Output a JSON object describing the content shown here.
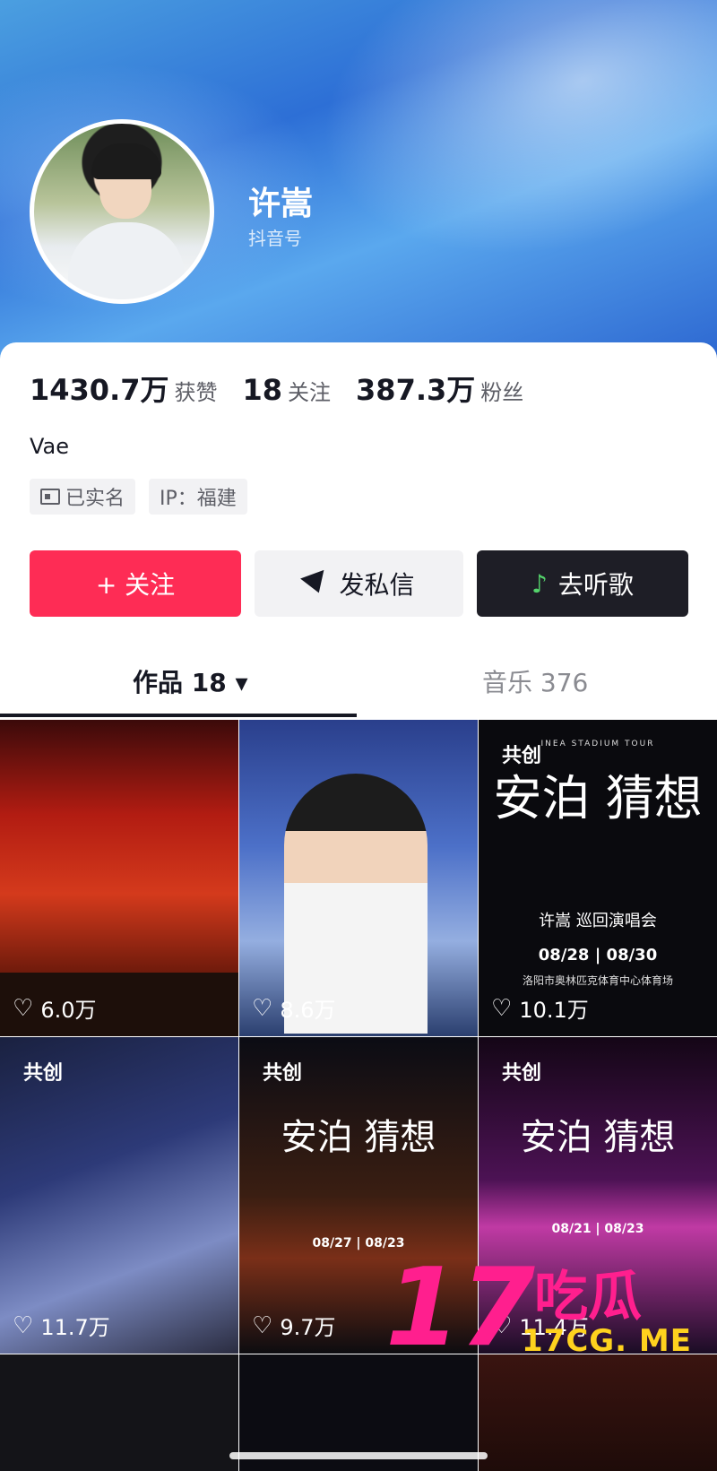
{
  "profile": {
    "name": "许嵩",
    "douyin_id": "抖音号",
    "bio": "Vae"
  },
  "stats": [
    {
      "value": "1430.7万",
      "label": "获赞"
    },
    {
      "value": "18",
      "label": "关注"
    },
    {
      "value": "387.3万",
      "label": "粉丝"
    }
  ],
  "tags": {
    "verified": "已实名",
    "ip": "IP：福建"
  },
  "actions": {
    "follow": "+ 关注",
    "message": "发私信",
    "music": "去听歌"
  },
  "tabs": {
    "works": "作品 18 ▾",
    "music": "音乐 376"
  },
  "grid": [
    {
      "likes": "6.0万",
      "collab": ""
    },
    {
      "likes": "8.6万",
      "collab": ""
    },
    {
      "likes": "10.1万",
      "collab": "共创",
      "poster_top": "INEA STADIUM TOUR",
      "poster_title": "安泊 猜想",
      "poster_sub": "许嵩 巡回演唱会",
      "poster_dates": "08/28 | 08/30",
      "poster_venue": "洛阳市奥林匹克体育中心体育场"
    },
    {
      "likes": "11.7万",
      "collab": "共创"
    },
    {
      "likes": "9.7万",
      "collab": "共创",
      "poster_title": "安泊 猜想",
      "poster_dates": "08/27 | 08/23"
    },
    {
      "likes": "11.4万",
      "collab": "共创",
      "poster_title": "安泊 猜想",
      "poster_dates": "08/21 | 08/23"
    }
  ],
  "watermark": {
    "number": "17",
    "brand": "吃瓜",
    "url": "17CG. ME"
  },
  "colors": {
    "follow": "#fe2c55",
    "music_button": "#1e1e26",
    "watermark_pink": "#ff1f8e",
    "watermark_yellow": "#ffd21e"
  }
}
